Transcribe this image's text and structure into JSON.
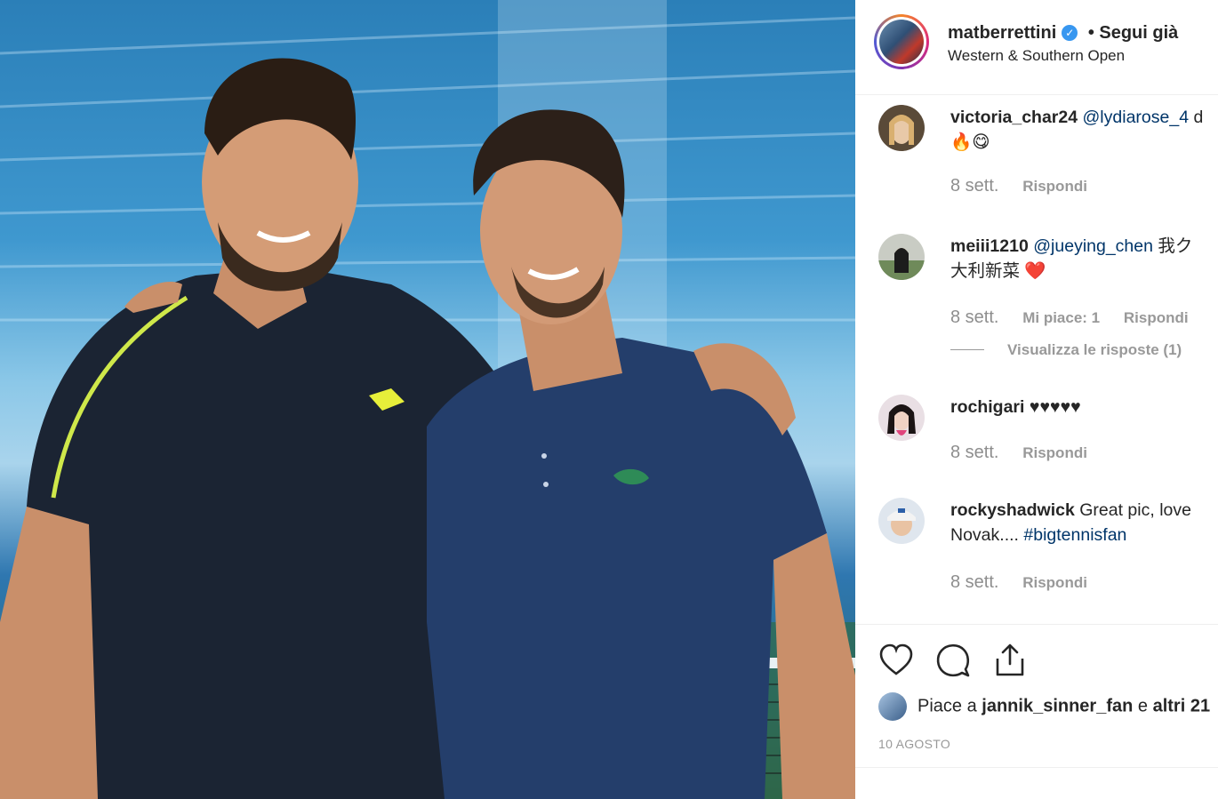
{
  "post": {
    "owner": "matberrettini",
    "verified_icon": "verified-badge-icon",
    "follow_status": "• Segui già",
    "location": "Western & Southern Open"
  },
  "comments": [
    {
      "user": "victoria_char24",
      "mention": "@lydiarose_4",
      "text": "",
      "text2": "🔥😋",
      "time": "8 sett.",
      "likes": "",
      "reply": "Rispondi"
    },
    {
      "user": "meiii1210",
      "mention": "@jueying_chen",
      "text": "我ク",
      "text2": "大利新菜 ❤️",
      "time": "8 sett.",
      "likes": "Mi piace: 1",
      "reply": "Rispondi",
      "view_replies": "Visualizza le risposte (1)"
    },
    {
      "user": "rochigari",
      "mention": "",
      "text": "♥♥♥♥♥",
      "text2": "",
      "time": "8 sett.",
      "likes": "",
      "reply": "Rispondi"
    },
    {
      "user": "rockyshadwick",
      "mention": "",
      "text": "Great pic, love",
      "text2": "Novak....",
      "hashtag": "#bigtennisfan",
      "time": "8 sett.",
      "likes": "",
      "reply": "Rispondi"
    }
  ],
  "actions": {
    "like_icon": "heart-icon",
    "comment_icon": "comment-bubble-icon",
    "share_icon": "share-icon"
  },
  "likes": {
    "prefix": "Piace a",
    "user": "jannik_sinner_fan",
    "middle": "e",
    "others": "altri 21"
  },
  "date": "10 AGOSTO"
}
